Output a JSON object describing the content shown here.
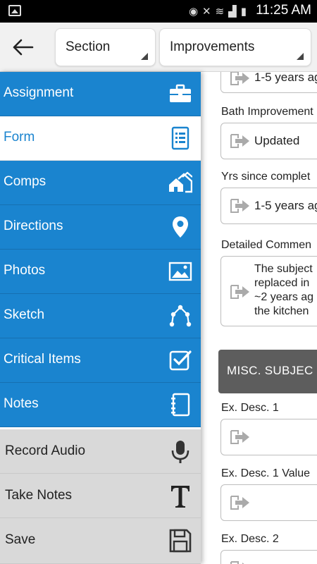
{
  "status_bar": {
    "time": "11:25 AM"
  },
  "header": {
    "section_dropdown": "Section",
    "subsection_dropdown": "Improvements"
  },
  "drawer": {
    "nav": [
      {
        "label": "Assignment",
        "icon": "briefcase-icon"
      },
      {
        "label": "Form",
        "icon": "form-list-icon",
        "active": true
      },
      {
        "label": "Comps",
        "icon": "houses-icon"
      },
      {
        "label": "Directions",
        "icon": "map-pin-icon"
      },
      {
        "label": "Photos",
        "icon": "photo-icon"
      },
      {
        "label": "Sketch",
        "icon": "sketch-icon"
      },
      {
        "label": "Critical Items",
        "icon": "checkbox-icon"
      },
      {
        "label": "Notes",
        "icon": "notebook-icon"
      }
    ],
    "tools": [
      {
        "label": "Record Audio",
        "icon": "microphone-icon"
      },
      {
        "label": "Take Notes",
        "icon": "text-t-icon"
      },
      {
        "label": "Save",
        "icon": "floppy-disk-icon"
      }
    ],
    "accent_color": "#1a84cf"
  },
  "form": {
    "top_partial_value": "1-5 years ag",
    "bath_improvements_label": "Bath Improvement",
    "bath_improvements_value": "Updated",
    "yrs_since_label": "Yrs since complet",
    "yrs_since_value": "1-5 years ag",
    "detailed_comments_label": "Detailed Commen",
    "detailed_comments_lines": [
      "The subject",
      "replaced in",
      "~2 years ag",
      "the kitchen"
    ],
    "section_heading": "MISC. SUBJEC",
    "ex_desc_1_label": "Ex. Desc. 1",
    "ex_desc_1_value": "",
    "ex_desc_1_value_label": "Ex. Desc. 1 Value",
    "ex_desc_1_value_value": "",
    "ex_desc_2_label": "Ex. Desc. 2",
    "ex_desc_2_value": ""
  }
}
